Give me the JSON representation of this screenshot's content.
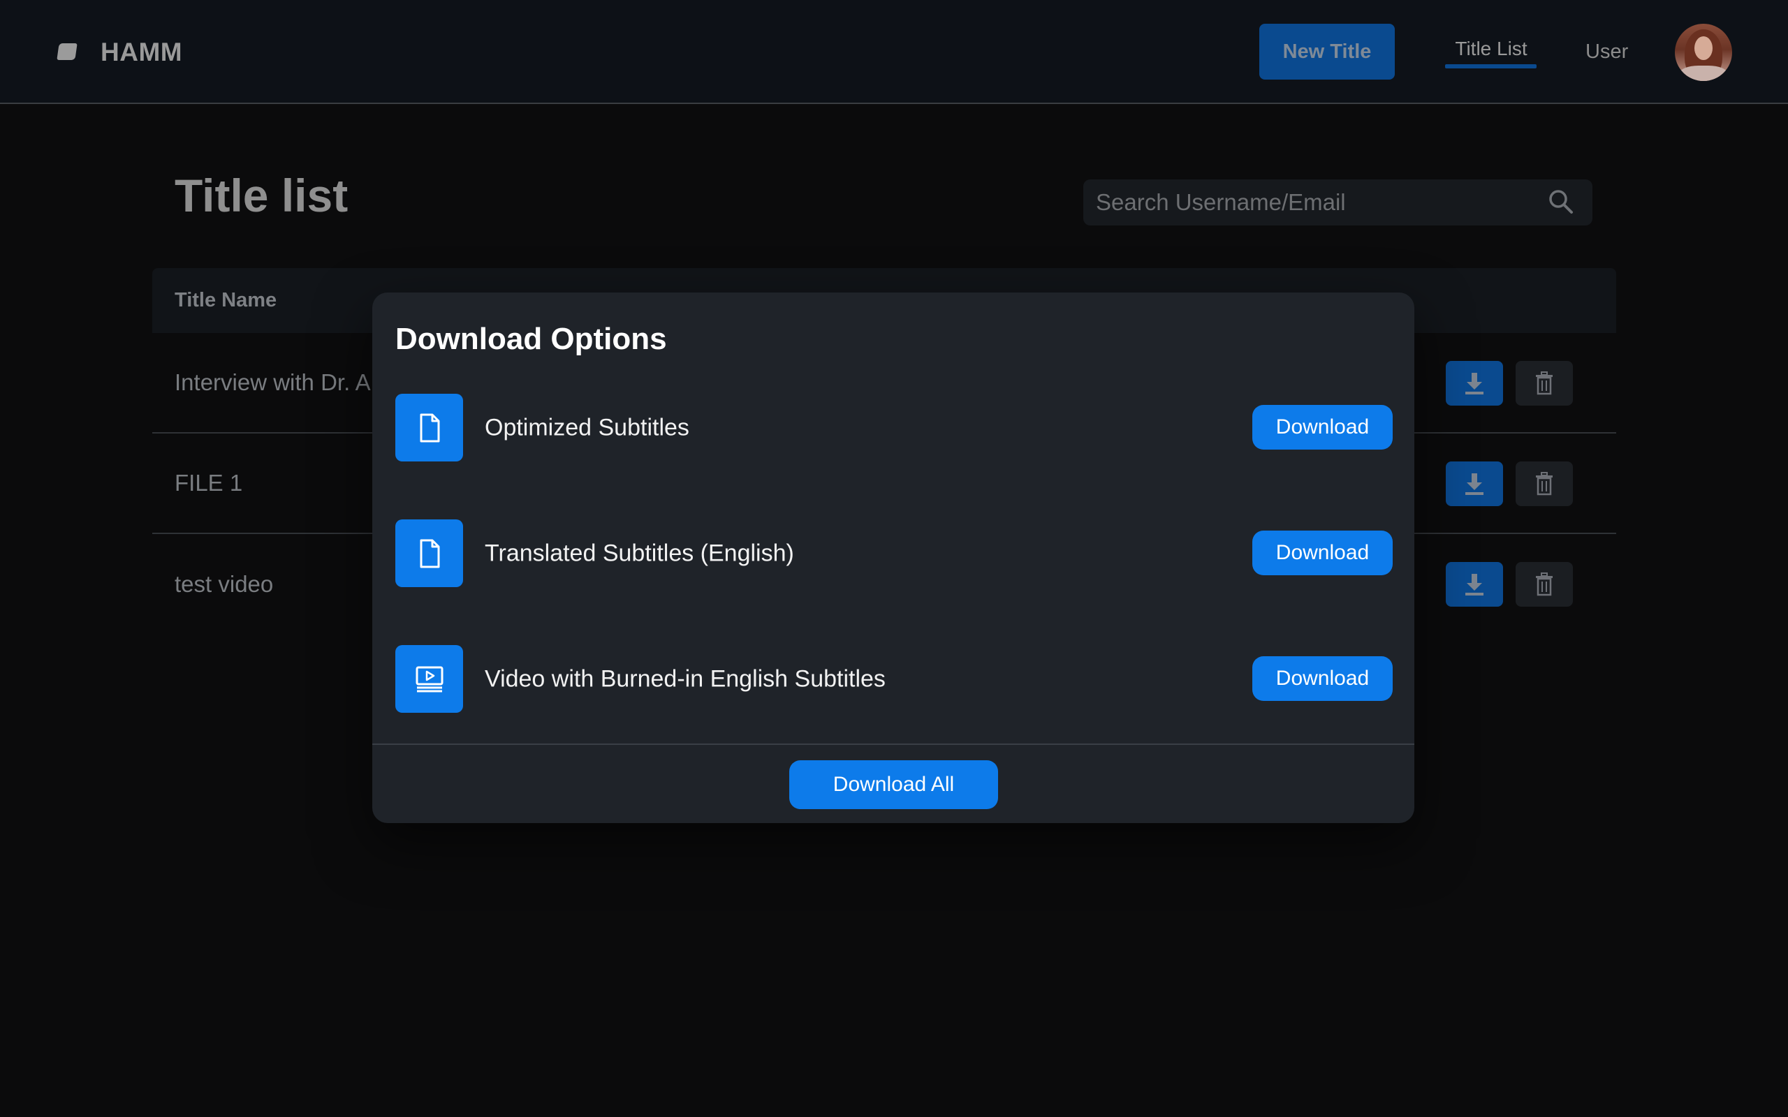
{
  "header": {
    "brand": "HAMM",
    "logo_icon": "logo-icon",
    "new_title_label": "New Title",
    "nav": [
      {
        "label": "Title List",
        "active": true
      },
      {
        "label": "User",
        "active": false
      }
    ],
    "avatar_icon": "user-avatar"
  },
  "page": {
    "title": "Title list",
    "search": {
      "placeholder": "Search Username/Email",
      "value": "",
      "icon": "search-icon"
    }
  },
  "table": {
    "columns": [
      "Title Name"
    ],
    "rows": [
      {
        "name": "Interview with Dr. A"
      },
      {
        "name": "FILE 1"
      },
      {
        "name": "test video"
      }
    ],
    "row_actions": {
      "download_icon": "download-icon",
      "delete_icon": "trash-icon"
    }
  },
  "modal": {
    "title": "Download Options",
    "options": [
      {
        "label": "Optimized Subtitles",
        "icon": "file-icon",
        "button": "Download"
      },
      {
        "label": "Translated Subtitles (English)",
        "icon": "file-icon",
        "button": "Download"
      },
      {
        "label": "Video with Burned-in English Subtitles",
        "icon": "video-icon",
        "button": "Download"
      }
    ],
    "download_all": "Download All"
  },
  "colors": {
    "accent": "#0d7bea",
    "accent_dim": "#0a4a8f",
    "modal_bg": "#1f2329",
    "page_bg": "#0b0b0c"
  }
}
